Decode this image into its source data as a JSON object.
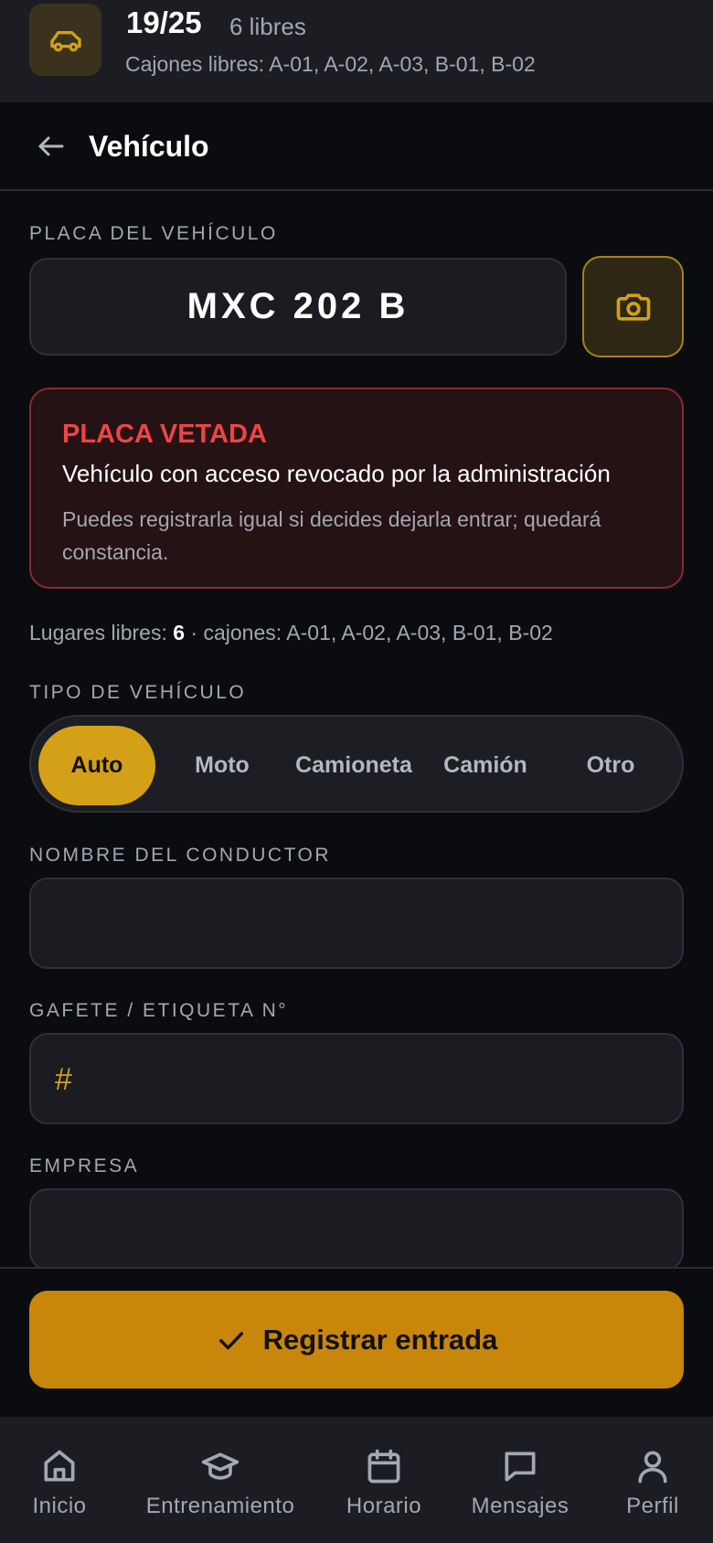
{
  "status": {
    "occupancy": "19/25",
    "free_label": "6 libres",
    "free_slots_line": "Cajones libres: A-01, A-02, A-03, B-01, B-02"
  },
  "header": {
    "title": "Vehículo"
  },
  "plate": {
    "label": "PLACA DEL VEHÍCULO",
    "value": "MXC 202 B"
  },
  "alert": {
    "title": "PLACA VETADA",
    "message": "Vehículo con acceso revocado por la administración",
    "note": "Puedes registrarla igual si decides dejarla entrar; quedará constancia."
  },
  "availability": {
    "prefix": "Lugares libres: ",
    "count": "6",
    "suffix": " · cajones: A-01, A-02, A-03, B-01, B-02"
  },
  "vehicle_type": {
    "label": "TIPO DE VEHÍCULO",
    "options": [
      "Auto",
      "Moto",
      "Camioneta",
      "Camión",
      "Otro"
    ],
    "selected": "Auto"
  },
  "driver": {
    "label": "NOMBRE DEL CONDUCTOR",
    "value": ""
  },
  "badge": {
    "label": "GAFETE / ETIQUETA N°",
    "prefix": "#",
    "value": ""
  },
  "company": {
    "label": "EMPRESA",
    "value": ""
  },
  "actions": {
    "register_label": "Registrar entrada"
  },
  "nav": [
    {
      "label": "Inicio",
      "icon": "home-icon"
    },
    {
      "label": "Entrenamiento",
      "icon": "graduation-cap-icon"
    },
    {
      "label": "Horario",
      "icon": "calendar-icon"
    },
    {
      "label": "Mensajes",
      "icon": "chat-icon"
    },
    {
      "label": "Perfil",
      "icon": "user-icon"
    }
  ],
  "colors": {
    "accent": "#d4a017",
    "danger": "#ef4444",
    "background": "#0b0c0f"
  }
}
